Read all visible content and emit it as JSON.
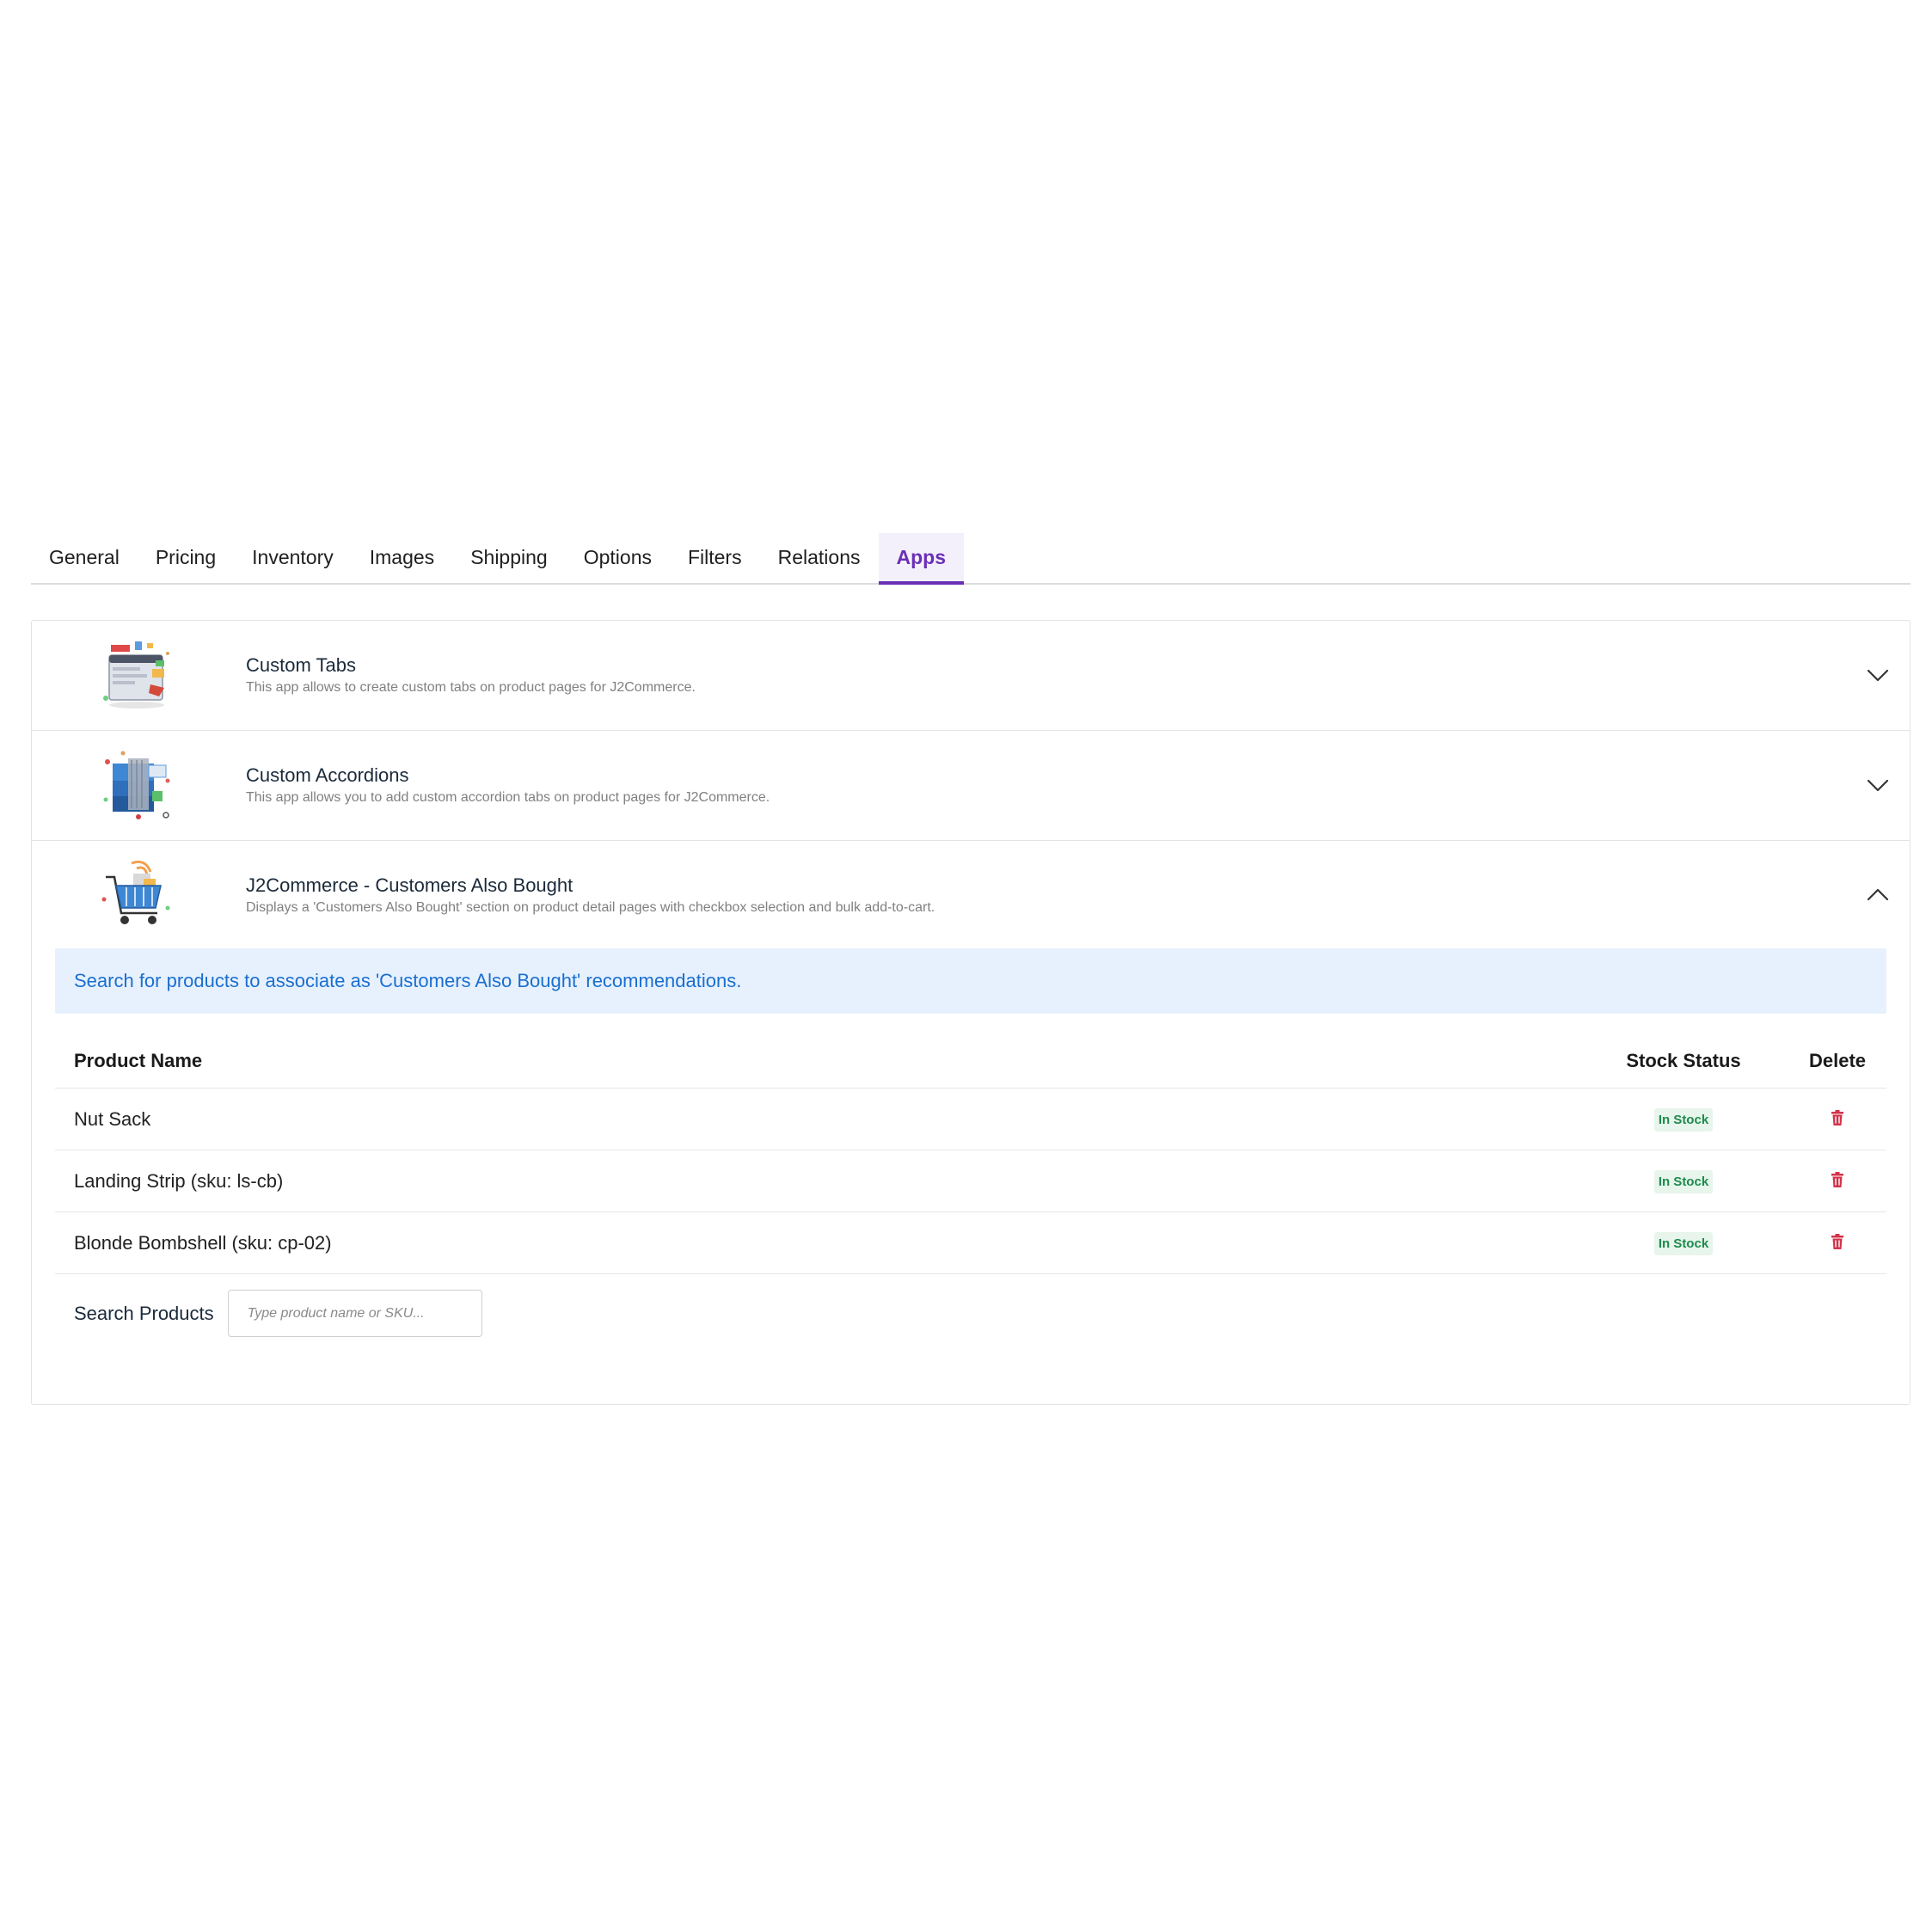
{
  "tabs": [
    {
      "label": "General"
    },
    {
      "label": "Pricing"
    },
    {
      "label": "Inventory"
    },
    {
      "label": "Images"
    },
    {
      "label": "Shipping"
    },
    {
      "label": "Options"
    },
    {
      "label": "Filters"
    },
    {
      "label": "Relations"
    },
    {
      "label": "Apps",
      "active": true
    }
  ],
  "apps": [
    {
      "title": "Custom Tabs",
      "description": "This app allows to create custom tabs on product pages for J2Commerce.",
      "icon": "browser-tabs-illustration-icon",
      "expanded": false
    },
    {
      "title": "Custom Accordions",
      "description": "This app allows you to add custom accordion tabs on product pages for J2Commerce.",
      "icon": "stacked-accordion-illustration-icon",
      "expanded": false
    },
    {
      "title": "J2Commerce - Customers Also Bought",
      "description": "Displays a 'Customers Also Bought' section on product detail pages with checkbox selection and bulk add-to-cart.",
      "icon": "shopping-cart-illustration-icon",
      "expanded": true
    }
  ],
  "panel": {
    "info": "Search for products to associate as 'Customers Also Bought' recommendations.",
    "columns": {
      "product": "Product Name",
      "stock": "Stock Status",
      "delete": "Delete"
    },
    "rows": [
      {
        "name": "Nut Sack",
        "stock": "In Stock"
      },
      {
        "name": "Landing Strip (sku: ls-cb)",
        "stock": "In Stock"
      },
      {
        "name": "Blonde Bombshell (sku: cp-02)",
        "stock": "In Stock"
      }
    ],
    "search": {
      "label": "Search Products",
      "placeholder": "Type product name or SKU..."
    }
  },
  "colors": {
    "accent": "#6a2fb5",
    "info_bg": "#e7f1fe",
    "info_text": "#1a6fcf",
    "in_stock_bg": "#e7f5ec",
    "in_stock_text": "#1e8a4c",
    "delete": "#d2334a"
  }
}
